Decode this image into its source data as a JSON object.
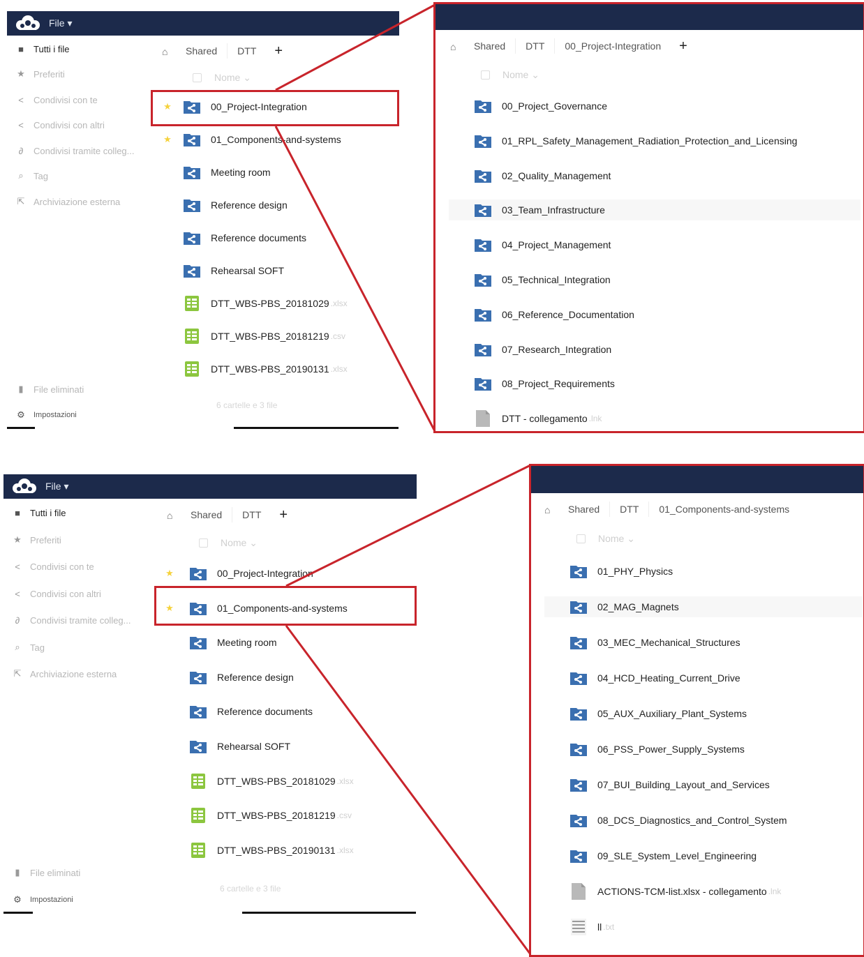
{
  "app": {
    "menu_label": "File ▾"
  },
  "colors": {
    "header": "#1c2a4b",
    "folder": "#3a6fb0",
    "spreadsheet": "#8cc63f",
    "highlight": "#c8242b",
    "star": "#f5d23c"
  },
  "sidebar": {
    "items": [
      {
        "label": "Tutti i file",
        "icon": "folder-icon"
      },
      {
        "label": "Preferiti",
        "icon": "star-icon"
      },
      {
        "label": "Condivisi con te",
        "icon": "share-icon"
      },
      {
        "label": "Condivisi con altri",
        "icon": "share-icon"
      },
      {
        "label": "Condivisi tramite colleg...",
        "icon": "link-icon"
      },
      {
        "label": "Tag",
        "icon": "tag-icon"
      },
      {
        "label": "Archiviazione esterna",
        "icon": "external-storage-icon"
      }
    ],
    "deleted": "File eliminati",
    "settings": "Impostazioni"
  },
  "panel1": {
    "breadcrumb": [
      "Shared",
      "DTT"
    ],
    "column_header": "Nome ⌄",
    "files": [
      {
        "name": "00_Project-Integration",
        "type": "shared-folder",
        "starred": true
      },
      {
        "name": "01_Components-and-systems",
        "type": "shared-folder",
        "starred": true
      },
      {
        "name": "Meeting room",
        "type": "shared-folder"
      },
      {
        "name": "Reference design",
        "type": "shared-folder"
      },
      {
        "name": "Reference documents",
        "type": "shared-folder"
      },
      {
        "name": "Rehearsal SOFT",
        "type": "shared-folder"
      },
      {
        "name": "DTT_WBS-PBS_20181029",
        "ext": ".xlsx",
        "type": "spreadsheet"
      },
      {
        "name": "DTT_WBS-PBS_20181219",
        "ext": ".csv",
        "type": "spreadsheet"
      },
      {
        "name": "DTT_WBS-PBS_20190131",
        "ext": ".xlsx",
        "type": "spreadsheet"
      }
    ],
    "summary": "6 cartelle e 3 file"
  },
  "zoom1": {
    "breadcrumb": [
      "Shared",
      "DTT",
      "00_Project-Integration"
    ],
    "column_header": "Nome ⌄",
    "files": [
      {
        "name": "00_Project_Governance",
        "type": "shared-folder"
      },
      {
        "name": "01_RPL_Safety_Management_Radiation_Protection_and_Licensing",
        "type": "shared-folder"
      },
      {
        "name": "02_Quality_Management",
        "type": "shared-folder"
      },
      {
        "name": "03_Team_Infrastructure",
        "type": "shared-folder"
      },
      {
        "name": "04_Project_Management",
        "type": "shared-folder"
      },
      {
        "name": "05_Technical_Integration",
        "type": "shared-folder"
      },
      {
        "name": "06_Reference_Documentation",
        "type": "shared-folder"
      },
      {
        "name": "07_Research_Integration",
        "type": "shared-folder"
      },
      {
        "name": "08_Project_Requirements",
        "type": "shared-folder"
      },
      {
        "name": "DTT - collegamento",
        "ext": ".lnk",
        "type": "file"
      }
    ]
  },
  "panel2": {
    "breadcrumb": [
      "Shared",
      "DTT"
    ],
    "column_header": "Nome ⌄",
    "files": [
      {
        "name": "00_Project-Integration",
        "type": "shared-folder",
        "starred": true
      },
      {
        "name": "01_Components-and-systems",
        "type": "shared-folder",
        "starred": true
      },
      {
        "name": "Meeting room",
        "type": "shared-folder"
      },
      {
        "name": "Reference design",
        "type": "shared-folder"
      },
      {
        "name": "Reference documents",
        "type": "shared-folder"
      },
      {
        "name": "Rehearsal SOFT",
        "type": "shared-folder"
      },
      {
        "name": "DTT_WBS-PBS_20181029",
        "ext": ".xlsx",
        "type": "spreadsheet"
      },
      {
        "name": "DTT_WBS-PBS_20181219",
        "ext": ".csv",
        "type": "spreadsheet"
      },
      {
        "name": "DTT_WBS-PBS_20190131",
        "ext": ".xlsx",
        "type": "spreadsheet"
      }
    ],
    "summary": "6 cartelle e 3 file"
  },
  "zoom2": {
    "breadcrumb": [
      "Shared",
      "DTT",
      "01_Components-and-systems"
    ],
    "column_header": "Nome ⌄",
    "files": [
      {
        "name": "01_PHY_Physics",
        "type": "shared-folder"
      },
      {
        "name": "02_MAG_Magnets",
        "type": "shared-folder"
      },
      {
        "name": "03_MEC_Mechanical_Structures",
        "type": "shared-folder"
      },
      {
        "name": "04_HCD_Heating_Current_Drive",
        "type": "shared-folder"
      },
      {
        "name": "05_AUX_Auxiliary_Plant_Systems",
        "type": "shared-folder"
      },
      {
        "name": "06_PSS_Power_Supply_Systems",
        "type": "shared-folder"
      },
      {
        "name": "07_BUI_Building_Layout_and_Services",
        "type": "shared-folder"
      },
      {
        "name": "08_DCS_Diagnostics_and_Control_System",
        "type": "shared-folder"
      },
      {
        "name": "09_SLE_System_Level_Engineering",
        "type": "shared-folder"
      },
      {
        "name": "ACTIONS-TCM-list.xlsx - collegamento",
        "ext": ".lnk",
        "type": "file"
      },
      {
        "name": "ll",
        "ext": ".txt",
        "type": "text-file"
      }
    ]
  }
}
